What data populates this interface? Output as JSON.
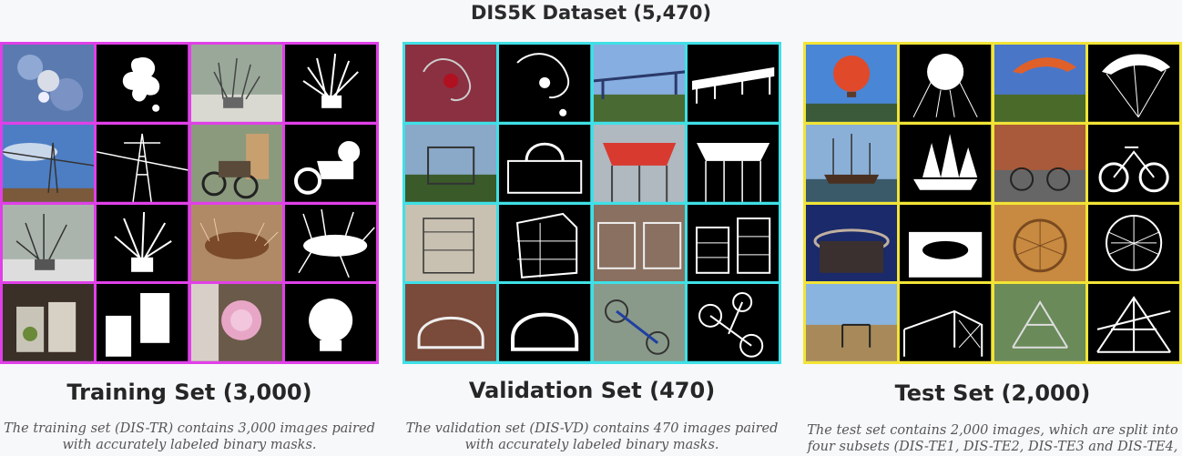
{
  "title": "DIS5K Dataset (5,470)",
  "panels": [
    {
      "key": "training",
      "border_color": "#e040e8",
      "heading": "Training Set (3,000)",
      "desc_lines": [
        "The training set (DIS-TR) contains 3,000 images paired",
        "with accurately labeled binary masks."
      ]
    },
    {
      "key": "validation",
      "border_color": "#3fe0e6",
      "heading": "Validation Set (470)",
      "desc_lines": [
        "The validation set (DIS-VD) contains 470 images paired",
        "with accurately labeled binary masks."
      ]
    },
    {
      "key": "test",
      "border_color": "#f2e436",
      "heading": "Test Set (2,000)",
      "desc_lines": [
        "The test set contains 2,000 images, which are split into",
        "four subsets (DIS-TE1, DIS-TE2, DIS-TE3 and DIS-TE4,"
      ]
    }
  ]
}
